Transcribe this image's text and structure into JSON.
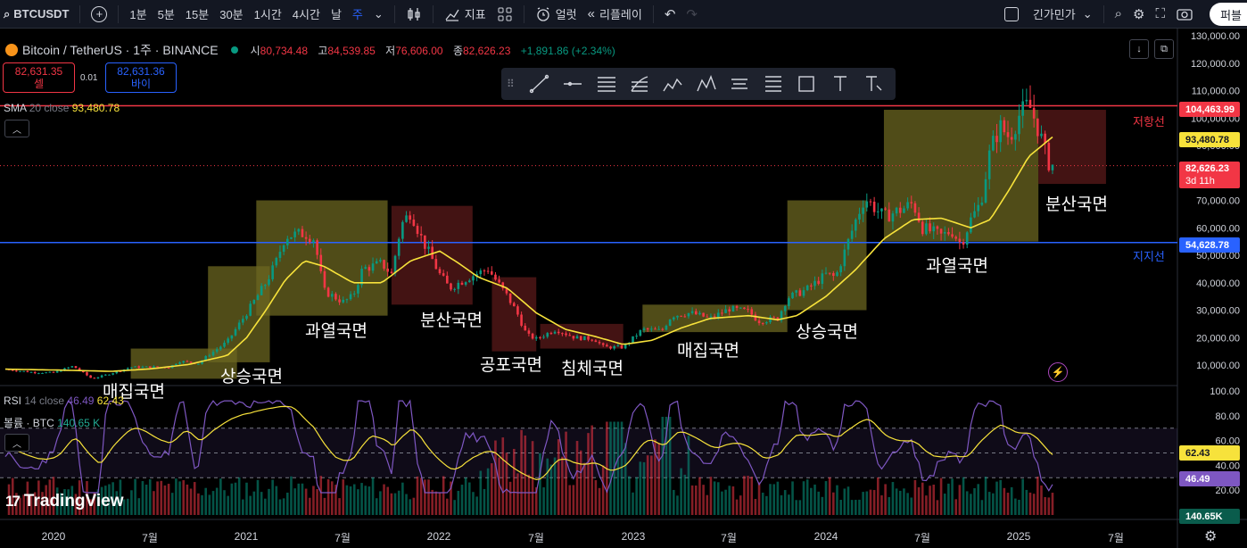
{
  "toolbar": {
    "symbol": "BTCUSDT",
    "intervals": [
      "1분",
      "5분",
      "15분",
      "30분",
      "1시간",
      "4시간",
      "날",
      "주"
    ],
    "active_interval": "주",
    "indicators_label": "지표",
    "alert_label": "얼럿",
    "replay_label": "리플레이",
    "layout_name": "긴가민가",
    "publish_label": "퍼블"
  },
  "legend": {
    "title": "Bitcoin / TetherUS · 1주 · BINANCE",
    "open_k": "시",
    "open": "80,734.48",
    "high_k": "고",
    "high": "84,539.85",
    "low_k": "저",
    "low": "76,606.00",
    "close_k": "종",
    "close": "82,626.23",
    "change": "+1,891.86 (+2.34%)"
  },
  "trade": {
    "sell_price": "82,631.35",
    "sell_label": "셀",
    "buy_price": "82,631.36",
    "buy_label": "바이",
    "spread": "0.01"
  },
  "sma": {
    "name": "SMA",
    "params": "20 close",
    "value": "93,480.78"
  },
  "rsi": {
    "name": "RSI",
    "params": "14 close",
    "value1": "46.49",
    "value2": "62.43"
  },
  "volume": {
    "name": "볼륨 · BTC",
    "value": "140.65 K"
  },
  "price_axis": {
    "ticks": [
      "130,000.00",
      "120,000.00",
      "110,000.00",
      "100,000.00",
      "90,000.00",
      "80,000.00",
      "70,000.00",
      "60,000.00",
      "50,000.00",
      "40,000.00",
      "30,000.00",
      "20,000.00",
      "10,000.00"
    ],
    "resistance_tag": "104,463.99",
    "sma_tag": "93,480.78",
    "last_price_tag": "82,626.23",
    "countdown": "3d 11h",
    "support_tag": "54,628.78"
  },
  "rsi_axis": {
    "ticks": [
      "100.00",
      "80.00",
      "60.00",
      "40.00",
      "20.00"
    ],
    "tag_upper": "62.43",
    "tag_rsi": "46.49",
    "tag_volume": "140.65K"
  },
  "lines": {
    "resistance_label": "저항선",
    "support_label": "지지선"
  },
  "phases": [
    "매집국면",
    "상승국면",
    "과열국면",
    "분산국면",
    "공포국면",
    "침체국면",
    "매집국면",
    "상승국면",
    "과열국면",
    "분산국면"
  ],
  "time_axis": [
    "2020",
    "7월",
    "2021",
    "7월",
    "2022",
    "7월",
    "2023",
    "7월",
    "2024",
    "7월",
    "2025",
    "7월"
  ],
  "logo": "TradingView",
  "colors": {
    "up": "#089981",
    "down": "#f23645",
    "sma": "#f7e23b",
    "rsi": "#7e57c2",
    "resistance": "#f23645",
    "support": "#2962ff",
    "box_olive": "#6b6620",
    "box_maroon": "#5a1a1a"
  },
  "chart_data": {
    "type": "candlestick",
    "interval": "1W",
    "y_ticks": [
      10000,
      20000,
      30000,
      40000,
      50000,
      60000,
      70000,
      80000,
      90000,
      100000,
      110000,
      120000,
      130000
    ],
    "resistance": 104463.99,
    "support": 54628.78,
    "last_close": 82626.23,
    "sma_last": 93480.78,
    "rsi_last": 46.49,
    "rsi_ma_last": 62.43,
    "rsi_ticks": [
      20,
      40,
      60,
      80,
      100
    ],
    "price_path": [
      [
        2019.75,
        8400
      ],
      [
        2019.9,
        7300
      ],
      [
        2020.0,
        7200
      ],
      [
        2020.1,
        9600
      ],
      [
        2020.2,
        5000
      ],
      [
        2020.3,
        7000
      ],
      [
        2020.4,
        9200
      ],
      [
        2020.5,
        9300
      ],
      [
        2020.6,
        9200
      ],
      [
        2020.65,
        11400
      ],
      [
        2020.75,
        10600
      ],
      [
        2020.8,
        13500
      ],
      [
        2020.9,
        18500
      ],
      [
        2021.0,
        29000
      ],
      [
        2021.1,
        40000
      ],
      [
        2021.15,
        47000
      ],
      [
        2021.2,
        57000
      ],
      [
        2021.3,
        58000
      ],
      [
        2021.35,
        56000
      ],
      [
        2021.4,
        37000
      ],
      [
        2021.5,
        33000
      ],
      [
        2021.55,
        35000
      ],
      [
        2021.6,
        45000
      ],
      [
        2021.7,
        47000
      ],
      [
        2021.75,
        43000
      ],
      [
        2021.8,
        61000
      ],
      [
        2021.85,
        66000
      ],
      [
        2021.9,
        57000
      ],
      [
        2022.0,
        43000
      ],
      [
        2022.05,
        38000
      ],
      [
        2022.15,
        42000
      ],
      [
        2022.25,
        45000
      ],
      [
        2022.35,
        35000
      ],
      [
        2022.4,
        29000
      ],
      [
        2022.45,
        21000
      ],
      [
        2022.5,
        19500
      ],
      [
        2022.6,
        23000
      ],
      [
        2022.7,
        20000
      ],
      [
        2022.8,
        19500
      ],
      [
        2022.85,
        16500
      ],
      [
        2022.95,
        16500
      ],
      [
        2023.05,
        23000
      ],
      [
        2023.15,
        22500
      ],
      [
        2023.2,
        28000
      ],
      [
        2023.3,
        29000
      ],
      [
        2023.4,
        27000
      ],
      [
        2023.5,
        30500
      ],
      [
        2023.6,
        29500
      ],
      [
        2023.65,
        26000
      ],
      [
        2023.75,
        27000
      ],
      [
        2023.8,
        34500
      ],
      [
        2023.9,
        37500
      ],
      [
        2024.0,
        43000
      ],
      [
        2024.05,
        42000
      ],
      [
        2024.15,
        62000
      ],
      [
        2024.2,
        71000
      ],
      [
        2024.3,
        64000
      ],
      [
        2024.4,
        67000
      ],
      [
        2024.45,
        69000
      ],
      [
        2024.5,
        60000
      ],
      [
        2024.6,
        57000
      ],
      [
        2024.65,
        59000
      ],
      [
        2024.7,
        54000
      ],
      [
        2024.75,
        63000
      ],
      [
        2024.8,
        69000
      ],
      [
        2024.85,
        88000
      ],
      [
        2024.9,
        97000
      ],
      [
        2024.95,
        93000
      ],
      [
        2025.0,
        101000
      ],
      [
        2025.05,
        105000
      ],
      [
        2025.1,
        96000
      ],
      [
        2025.15,
        84000
      ],
      [
        2025.18,
        82626
      ]
    ],
    "sma_path": [
      [
        2019.75,
        8500
      ],
      [
        2020.0,
        8200
      ],
      [
        2020.3,
        7700
      ],
      [
        2020.5,
        8600
      ],
      [
        2020.7,
        10200
      ],
      [
        2020.9,
        13500
      ],
      [
        2021.0,
        20000
      ],
      [
        2021.1,
        30000
      ],
      [
        2021.2,
        41000
      ],
      [
        2021.3,
        48000
      ],
      [
        2021.4,
        46000
      ],
      [
        2021.55,
        40000
      ],
      [
        2021.7,
        40000
      ],
      [
        2021.85,
        48000
      ],
      [
        2022.0,
        51500
      ],
      [
        2022.1,
        47000
      ],
      [
        2022.2,
        42000
      ],
      [
        2022.35,
        38000
      ],
      [
        2022.5,
        29000
      ],
      [
        2022.65,
        23000
      ],
      [
        2022.8,
        20500
      ],
      [
        2022.95,
        17500
      ],
      [
        2023.1,
        19000
      ],
      [
        2023.25,
        23500
      ],
      [
        2023.4,
        27000
      ],
      [
        2023.6,
        28000
      ],
      [
        2023.75,
        26500
      ],
      [
        2023.85,
        28000
      ],
      [
        2024.0,
        35000
      ],
      [
        2024.15,
        44500
      ],
      [
        2024.3,
        56000
      ],
      [
        2024.45,
        63000
      ],
      [
        2024.6,
        63500
      ],
      [
        2024.75,
        60000
      ],
      [
        2024.85,
        63000
      ],
      [
        2024.95,
        74000
      ],
      [
        2025.05,
        86000
      ],
      [
        2025.18,
        93480
      ]
    ]
  }
}
